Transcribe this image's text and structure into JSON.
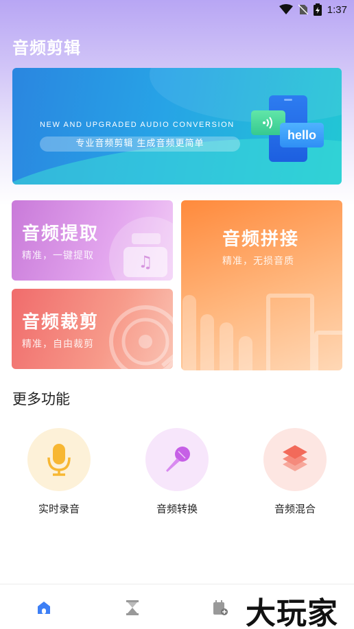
{
  "status_bar": {
    "time": "1:37"
  },
  "app": {
    "title": "音频剪辑"
  },
  "banner": {
    "headline_en": "NEW AND UPGRADED AUDIO CONVERSION",
    "slogan": "专业音频剪辑   生成音频更简单",
    "bubble_text": "hello"
  },
  "cards": {
    "extract": {
      "title": "音频提取",
      "subtitle": "精准，一键提取"
    },
    "trim": {
      "title": "音频裁剪",
      "subtitle": "精准，自由裁剪"
    },
    "join": {
      "title": "音频拼接",
      "subtitle": "精准，无损音质"
    }
  },
  "more_section": {
    "title": "更多功能",
    "features": [
      {
        "label": "实时录音",
        "icon": "microphone-icon",
        "bg": "#fdf1d8",
        "color": "#f7b733"
      },
      {
        "label": "音频转换",
        "icon": "karaoke-mic-icon",
        "bg": "#f7e6fb",
        "color": "#c660e6"
      },
      {
        "label": "音频混合",
        "icon": "layers-icon",
        "bg": "#fde6e2",
        "color": "#f26a5a"
      }
    ]
  },
  "bottom_nav": {
    "items": [
      {
        "icon": "home-icon",
        "active": true,
        "color": "#3d7ff5"
      },
      {
        "icon": "hourglass-icon",
        "active": false
      },
      {
        "icon": "calendar-add-icon",
        "active": false
      }
    ]
  },
  "watermark": "大玩家"
}
